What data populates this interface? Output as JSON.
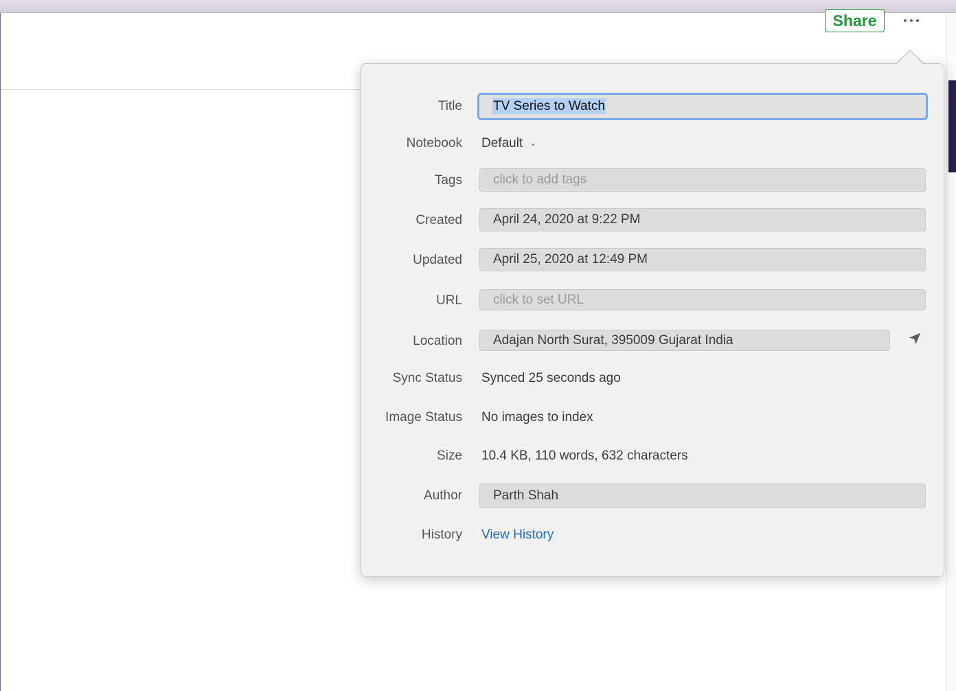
{
  "toolbar": {
    "share_label": "Share",
    "more_icon": "ellipsis-icon"
  },
  "note_info": {
    "title": {
      "label": "Title",
      "value": "TV Series to Watch"
    },
    "notebook": {
      "label": "Notebook",
      "value": "Default"
    },
    "tags": {
      "label": "Tags",
      "placeholder": "click to add tags"
    },
    "created": {
      "label": "Created",
      "value": "April 24, 2020 at 9:22 PM"
    },
    "updated": {
      "label": "Updated",
      "value": "April 25, 2020 at 12:49 PM"
    },
    "url": {
      "label": "URL",
      "placeholder": "click to set URL"
    },
    "location": {
      "label": "Location",
      "value": "Adajan North Surat, 395009 Gujarat India",
      "icon": "location-arrow-icon"
    },
    "sync_status": {
      "label": "Sync Status",
      "value": "Synced 25 seconds ago"
    },
    "image_status": {
      "label": "Image Status",
      "value": "No images to index"
    },
    "size": {
      "label": "Size",
      "value": "10.4 KB, 110 words, 632 characters"
    },
    "author": {
      "label": "Author",
      "value": "Parth Shah"
    },
    "history": {
      "label": "History",
      "link_label": "View History"
    }
  },
  "colors": {
    "share_green": "#1f9a3a",
    "link_blue": "#1a6fc4",
    "focus_ring": "#7aa7e6",
    "selection": "#b3d0f5"
  }
}
